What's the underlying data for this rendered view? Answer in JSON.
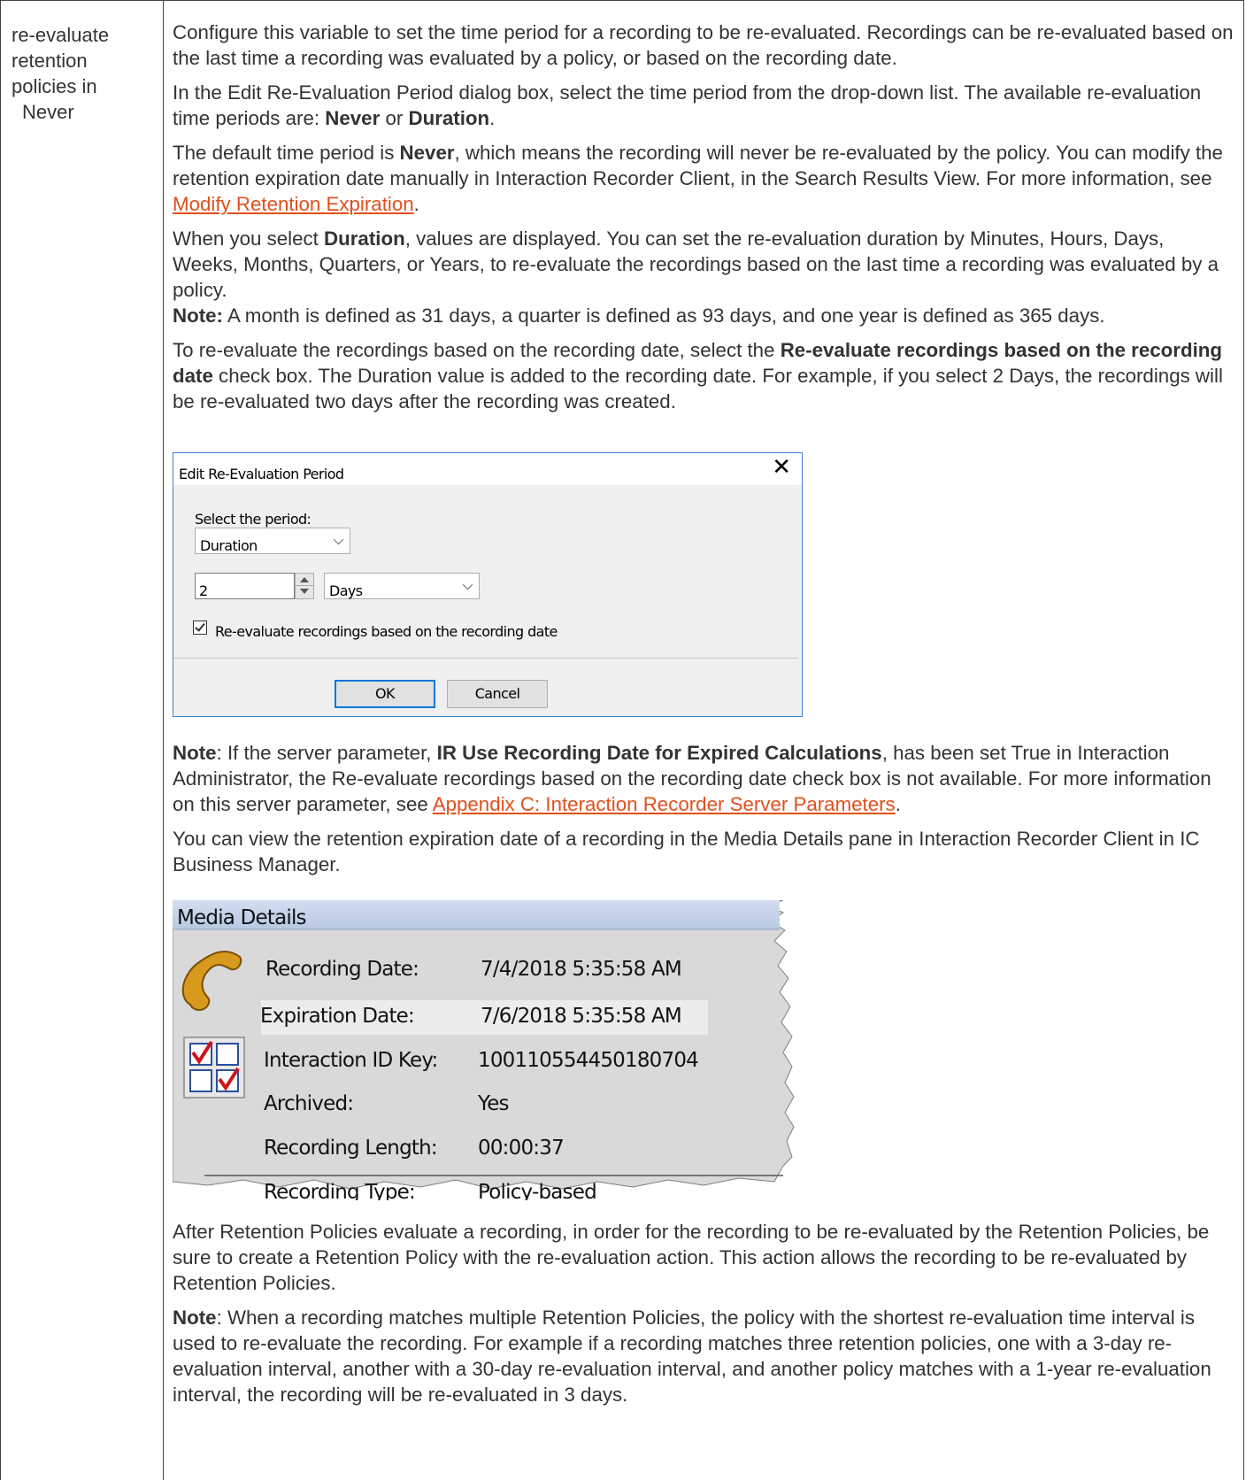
{
  "term": {
    "line1": "re-evaluate",
    "line2": "retention",
    "line3": "policies in",
    "line4": "Never"
  },
  "p1": "Configure this variable to set the time period for a recording to be re-evaluated. Recordings can be re-evaluated based on the last time a recording was evaluated by a policy, or based on the recording date.",
  "p2": {
    "pre": "In the Edit Re-Evaluation Period dialog box, select the time period from the drop-down list. The available re-evaluation time periods are: ",
    "b1": "Never",
    "mid": " or ",
    "b2": "Duration",
    "post": "."
  },
  "p3": {
    "pre": "The default time period is ",
    "b1": "Never",
    "post": ", which means the recording will never be re-evaluated by the policy. You can modify the retention expiration date manually in Interaction Recorder Client, in the Search Results View. For more information, see ",
    "link": "Modify Retention Expiration",
    "end": "."
  },
  "p4": {
    "pre": "When you select ",
    "b1": "Duration",
    "post": ", values are displayed. You can set the re-evaluation duration by Minutes, Hours, Days, Weeks, Months, Quarters, or Years, to re-evaluate the recordings based on the last time a recording was evaluated by a policy.",
    "note_label": "Note:",
    "note_text": " A month is defined as 31 days, a quarter is defined as 93 days, and one year is defined as 365 days."
  },
  "p5": {
    "pre": "To re-evaluate the recordings based on the recording date, select the ",
    "b1": "Re-evaluate recordings based on the recording date",
    "post": " check box. The Duration value is added to the recording date. For example, if you select 2 Days, the recordings will be re-evaluated two days after the recording was created."
  },
  "dialog": {
    "title": "Edit Re-Evaluation Period",
    "close": "✕",
    "select_label": "Select the period:",
    "period_value": "Duration",
    "amount_value": "2",
    "unit_value": "Days",
    "checkbox_label": "Re-evaluate recordings based on the recording date",
    "ok": "OK",
    "cancel": "Cancel"
  },
  "p6": {
    "note_label": "Note",
    "pre": ": If the server parameter, ",
    "b1": "IR Use Recording Date for Expired Calculations",
    "post": ", has been set True in Interaction Administrator, the Re-evaluate recordings based on the recording date check box is not available. For more information on this server parameter, see ",
    "link": "Appendix C: Interaction Recorder Server Parameters",
    "end": "."
  },
  "p7": "You can view the retention expiration date of a recording in the Media Details pane in Interaction Recorder Client in IC Business Manager.",
  "media": {
    "title": "Media Details",
    "rows": [
      {
        "label": "Recording Date:",
        "value": "7/4/2018 5:35:58 AM"
      },
      {
        "label": "Expiration Date:",
        "value": "7/6/2018 5:35:58 AM"
      },
      {
        "label": "Interaction ID Key:",
        "value": "100110554450180704"
      },
      {
        "label": "Archived:",
        "value": "Yes"
      },
      {
        "label": "Recording Length:",
        "value": "00:00:37"
      },
      {
        "label": "Recording Type:",
        "value": "Policy-based"
      }
    ]
  },
  "p8": "After Retention Policies evaluate a recording, in order for the recording to be re-evaluated by the Retention Policies, be sure to create a Retention Policy with the re-evaluation action. This action allows the recording to be re-evaluated by Retention Policies.",
  "p9": {
    "note_label": "Note",
    "text": ": When a recording matches multiple Retention Policies, the policy with the shortest re-evaluation time interval is used to re-evaluate the recording. For example if a recording matches three retention policies, one with a 3-day re-evaluation interval, another with a 30-day re-evaluation interval, and another policy matches with a 1-year re-evaluation interval, the recording will be re-evaluated in 3 days."
  }
}
